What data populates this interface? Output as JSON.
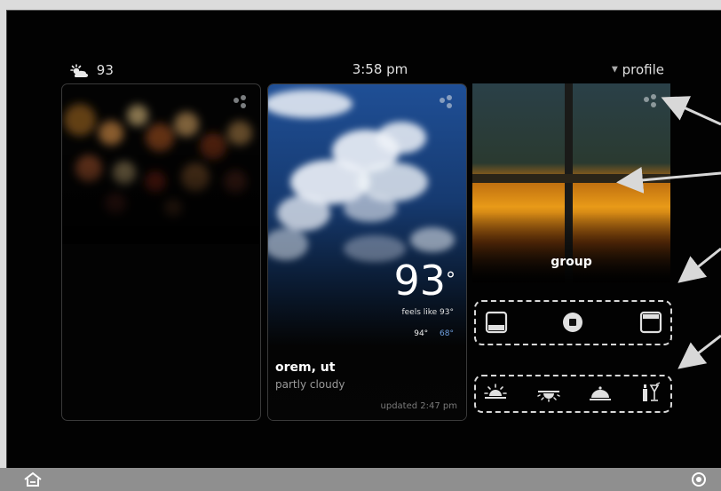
{
  "status_bar": {
    "weather_temp": "93",
    "time": "3:58 pm",
    "profile_label": "profile"
  },
  "weather_card": {
    "temperature": "93",
    "degree_symbol": "°",
    "feels_like": "feels like 93°",
    "high": "94°",
    "low": "68°",
    "location": "orem, ut",
    "condition": "partly cloudy",
    "updated": "updated 2:47 pm"
  },
  "group_card": {
    "label": "group"
  },
  "controls_row": [
    "shade-down-icon",
    "stop-icon",
    "shade-up-icon"
  ],
  "scenes_row": [
    "sunrise-icon",
    "sunset-icon",
    "dinner-icon",
    "bar-icon"
  ],
  "colors": {
    "screen_bg": "#020202",
    "bar_bg": "#8f8f8f",
    "low_temp": "#6fa0e0"
  }
}
